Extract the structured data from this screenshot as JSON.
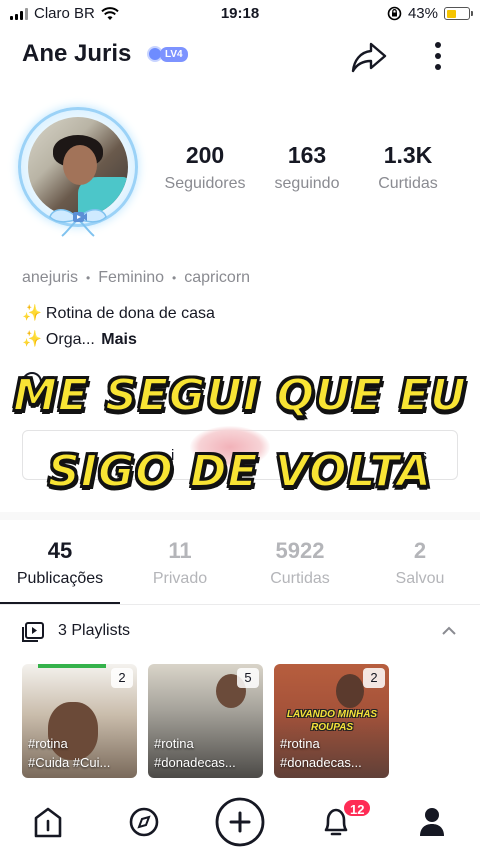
{
  "status_bar": {
    "carrier": "Claro BR",
    "time": "19:18",
    "battery": "43%",
    "battery_level": 0.43
  },
  "header": {
    "username": "Ane Juris",
    "level": "LV4",
    "share_icon": "share-arrow-icon",
    "more_icon": "more-vertical-icon"
  },
  "stats": [
    {
      "value": "200",
      "label": "Seguidores"
    },
    {
      "value": "163",
      "label": "seguindo"
    },
    {
      "value": "1.3K",
      "label": "Curtidas"
    }
  ],
  "meta": {
    "handle": "anejuris",
    "gender": "Feminino",
    "sign": "capricorn"
  },
  "bio": {
    "line1": "Rotina de dona de casa",
    "line2": "Orga...",
    "more": "Mais"
  },
  "overlay": {
    "line1": "ME SEGUI QUE EU",
    "line2": "SIGO DE VOLTA"
  },
  "action_box": {
    "left_fragment": "i",
    "right_fragment": "s"
  },
  "tabs": [
    {
      "count": "45",
      "label": "Publicações",
      "active": true
    },
    {
      "count": "11",
      "label": "Privado",
      "active": false
    },
    {
      "count": "5922",
      "label": "Curtidas",
      "active": false
    },
    {
      "count": "2",
      "label": "Salvou",
      "active": false
    }
  ],
  "playlists": {
    "label": "3 Playlists",
    "cards": [
      {
        "count": "2",
        "tag1": "#rotina",
        "tag2": "#Cuida #Cui..."
      },
      {
        "count": "5",
        "tag1": "#rotina",
        "tag2": "#donadecas..."
      },
      {
        "count": "2",
        "tag1": "#rotina",
        "tag2": "#donadecas...",
        "banner": "LAVANDO MINHAS ROUPAS"
      }
    ]
  },
  "bottom_nav": {
    "items": [
      "home-icon",
      "explore-icon",
      "create-icon",
      "notifications-icon",
      "profile-icon"
    ],
    "notifications_badge": "12"
  },
  "colors": {
    "accent": "#fe2c55",
    "overlay_yellow": "#f8e434",
    "level_badge": "#7d93ff",
    "muted_text": "#8a8b91"
  }
}
